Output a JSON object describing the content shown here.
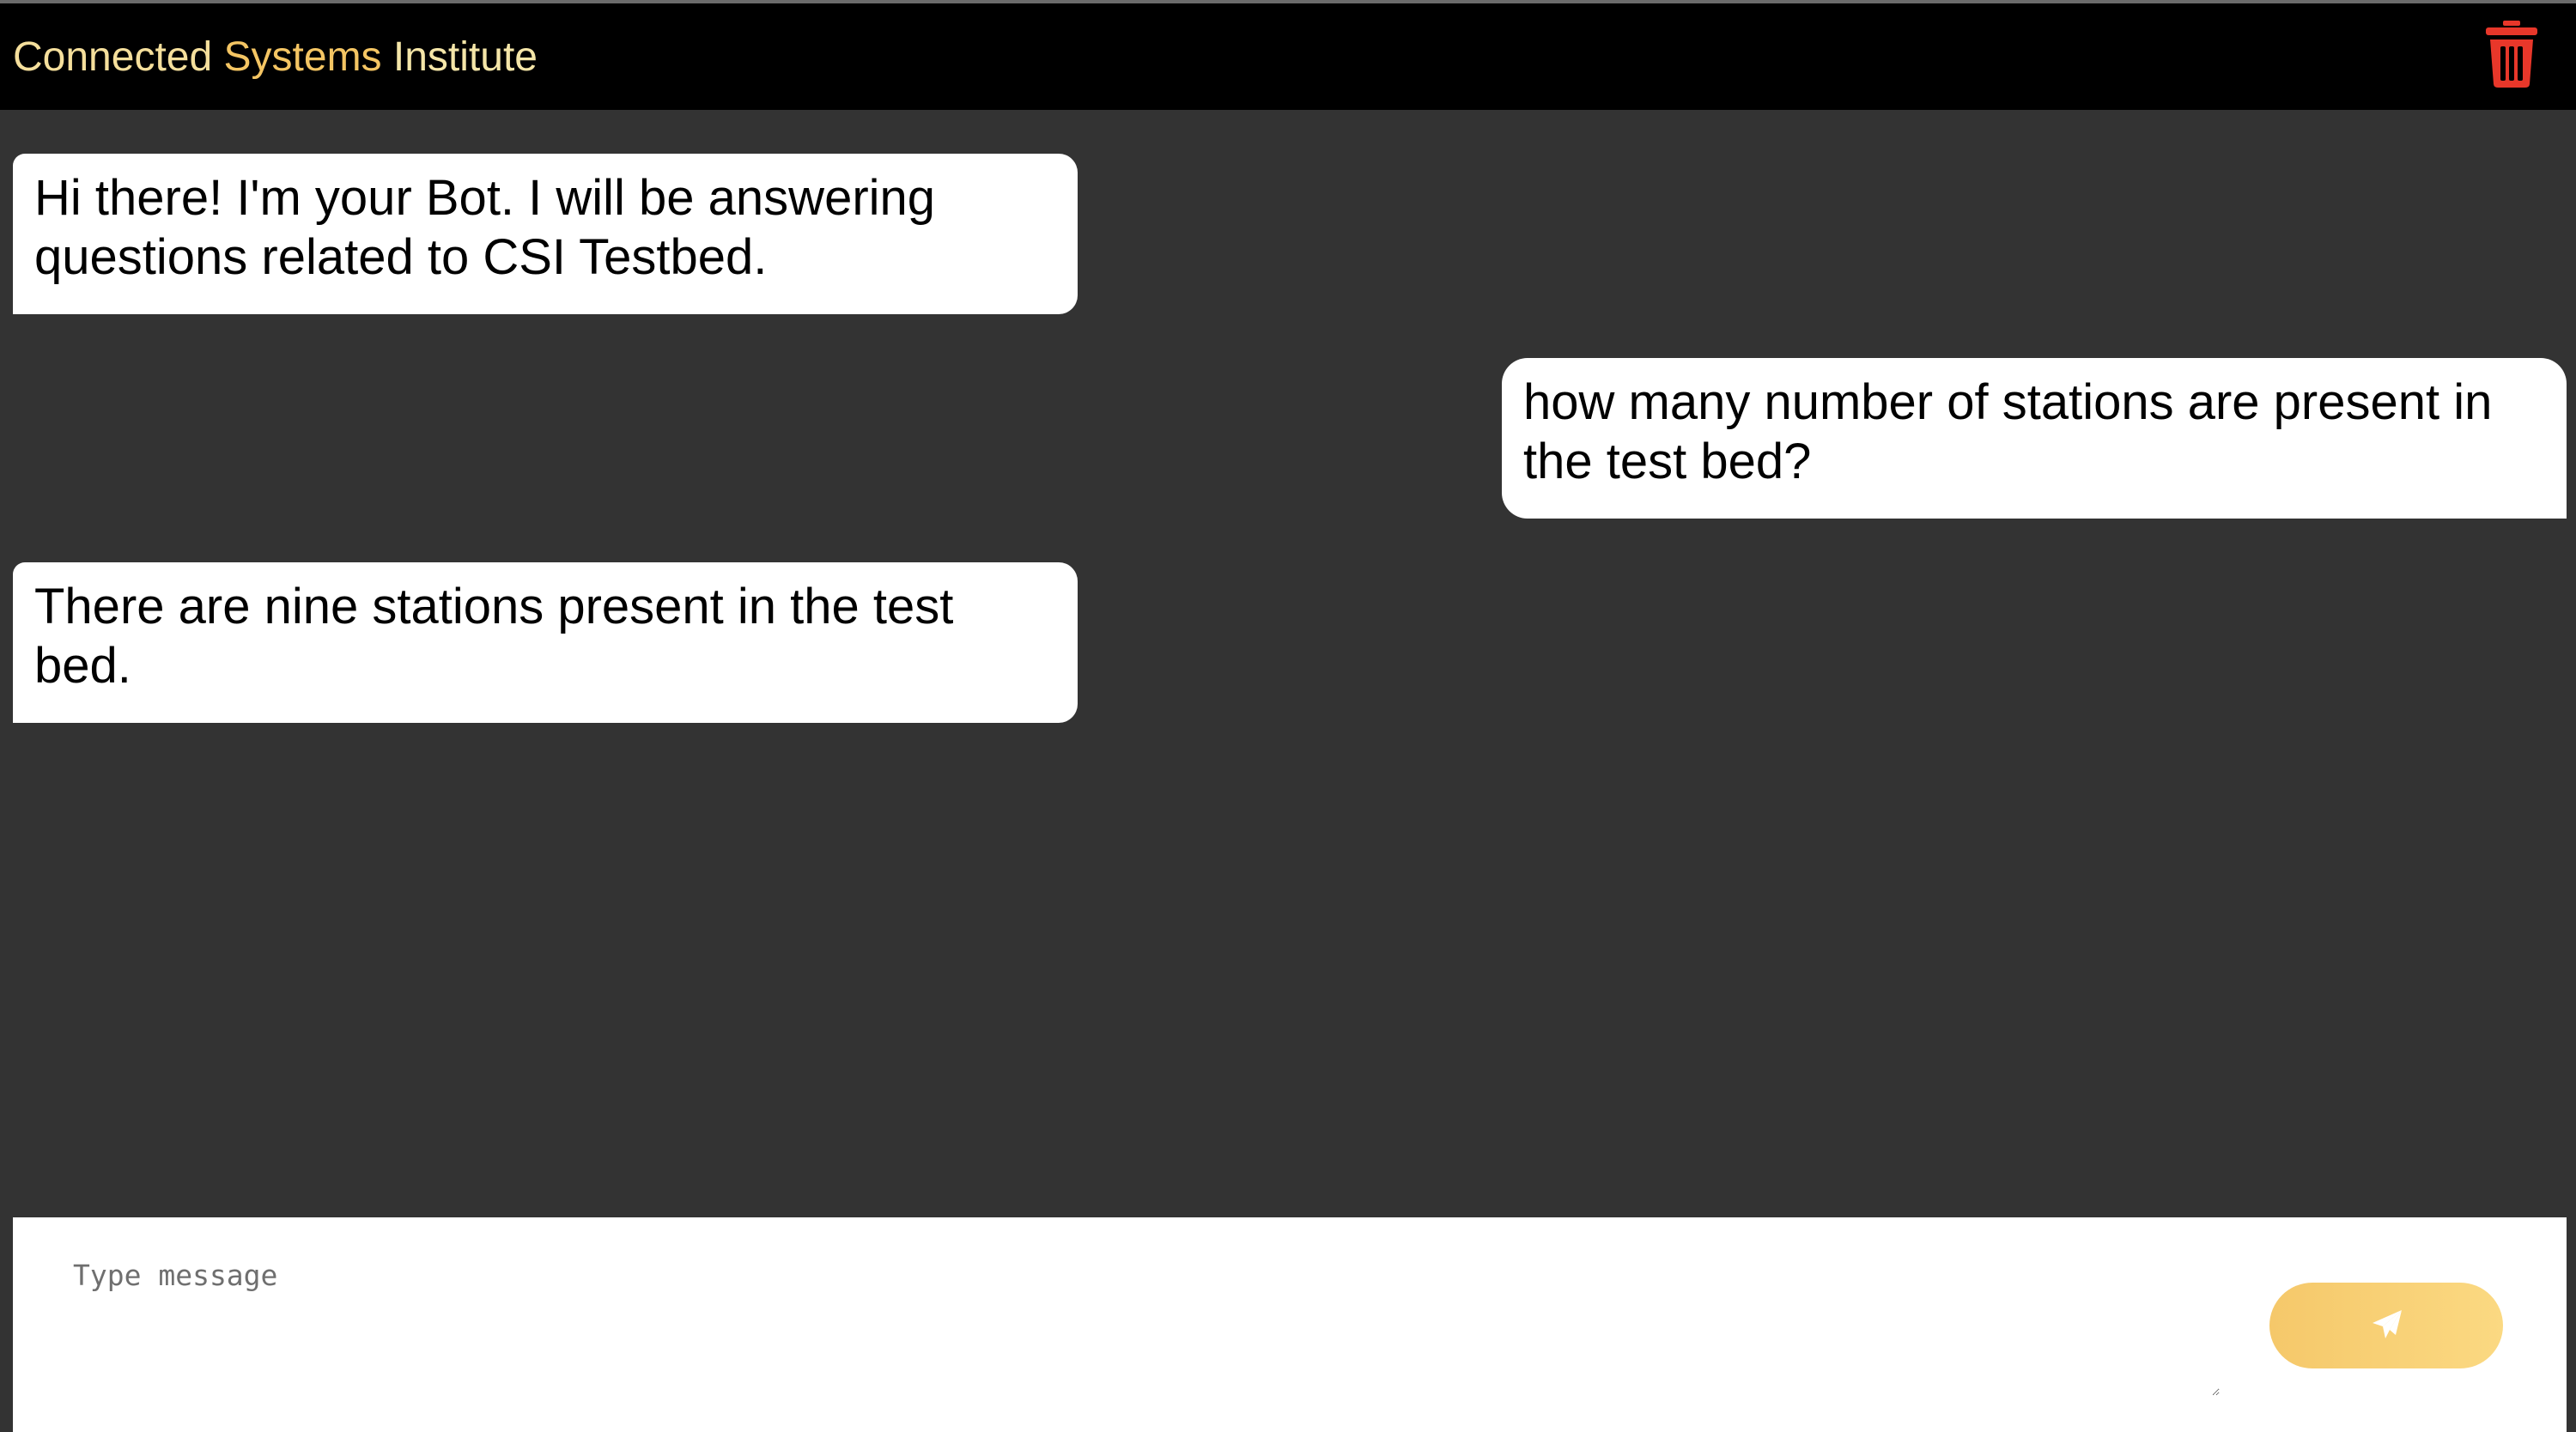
{
  "header": {
    "title_part1": "Connected",
    "title_part2": "Systems",
    "title_part3": "Institute",
    "delete_icon": "trash-icon",
    "delete_color": "#e8372a",
    "background": "#000000"
  },
  "messages": [
    {
      "sender": "bot",
      "text": "Hi there! I'm your Bot. I will be answering questions related to CSI Testbed."
    },
    {
      "sender": "user",
      "text": "how many number of stations are present in the test bed?"
    },
    {
      "sender": "bot",
      "text": "There are nine stations present in the test bed."
    }
  ],
  "composer": {
    "placeholder": "Type message",
    "value": "",
    "send_icon": "paper-plane-icon",
    "send_color": "#f5c86a"
  },
  "colors": {
    "chat_background": "#333333",
    "bubble_background": "#ffffff"
  }
}
